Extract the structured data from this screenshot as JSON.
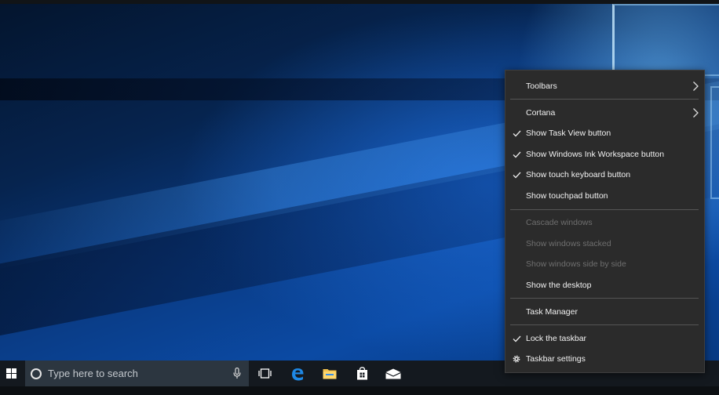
{
  "taskbar": {
    "search_placeholder": "Type here to search"
  },
  "context_menu": {
    "toolbars": "Toolbars",
    "cortana": "Cortana",
    "show_task_view": "Show Task View button",
    "show_ink_workspace": "Show Windows Ink Workspace button",
    "show_touch_keyboard": "Show touch keyboard button",
    "show_touchpad": "Show touchpad button",
    "cascade_windows": "Cascade windows",
    "show_stacked": "Show windows stacked",
    "show_side_by_side": "Show windows side by side",
    "show_desktop": "Show the desktop",
    "task_manager": "Task Manager",
    "lock_taskbar": "Lock the taskbar",
    "taskbar_settings": "Taskbar settings"
  },
  "icons": {
    "start": "windows-logo-icon",
    "cortana": "cortana-circle-icon",
    "mic": "microphone-icon",
    "task_view": "task-view-icon",
    "edge": "edge-browser-icon",
    "explorer": "file-explorer-icon",
    "store": "store-bag-icon",
    "mail": "mail-icon",
    "check": "checkmark-icon",
    "chevron": "chevron-right-icon",
    "settings": "gear-icon"
  },
  "colors": {
    "menu_bg": "#2b2b2b",
    "taskbar_bg": "#14191f",
    "search_bg": "#2c3640",
    "edge_blue": "#1e88e5",
    "folder_yellow": "#f2c14e",
    "disabled_text": "#6f6f6f"
  }
}
